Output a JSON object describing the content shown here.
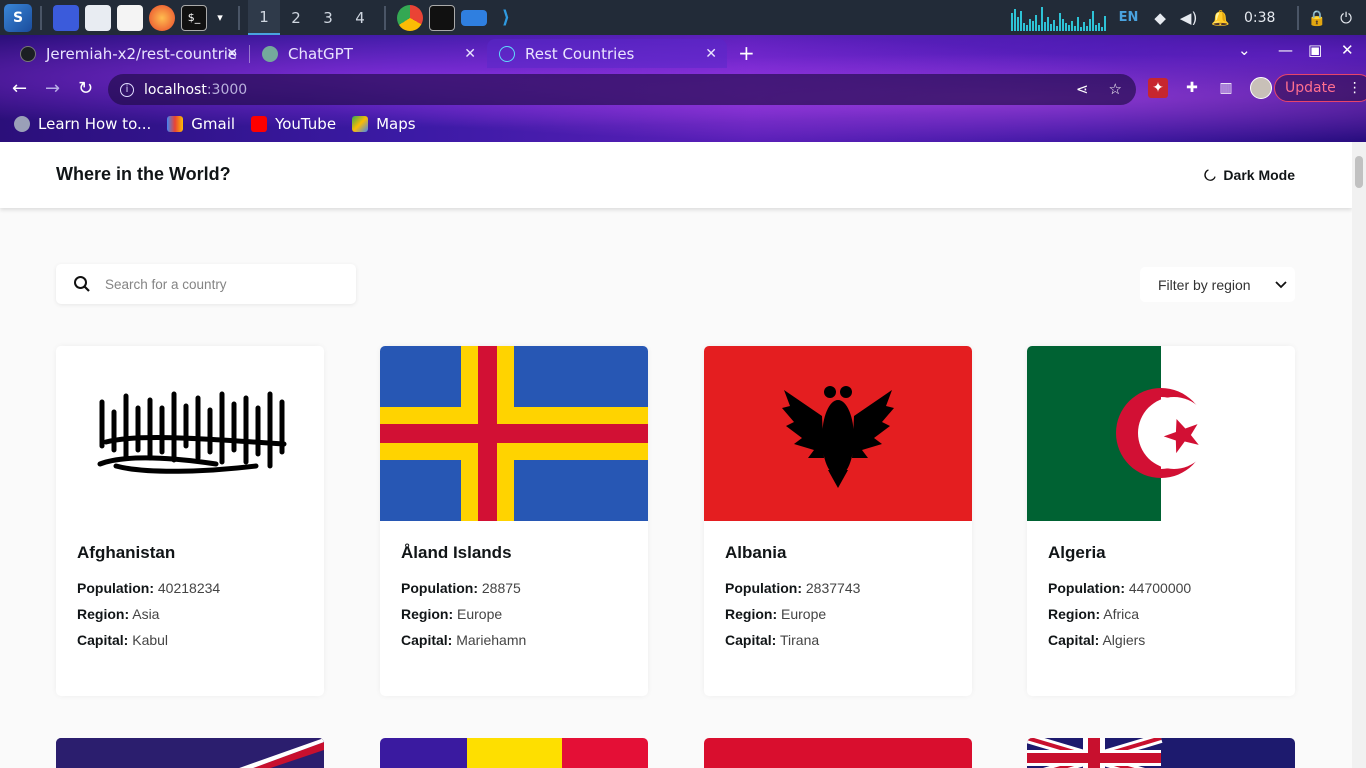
{
  "taskbar": {
    "workspaces": [
      "1",
      "2",
      "3",
      "4"
    ],
    "language": "EN",
    "clock": "0:38"
  },
  "browser": {
    "tabs": [
      {
        "title": "Jeremiah-x2/rest-countrie"
      },
      {
        "title": "ChatGPT"
      },
      {
        "title": "Rest Countries"
      }
    ],
    "url_host": "localhost",
    "url_port": ":3000",
    "update_label": "Update",
    "bookmarks": [
      {
        "label": "Learn How to..."
      },
      {
        "label": "Gmail"
      },
      {
        "label": "YouTube"
      },
      {
        "label": "Maps"
      }
    ]
  },
  "app": {
    "title": "Where in the World?",
    "dark_mode_label": "Dark Mode",
    "search_placeholder": "Search for a country",
    "filter_label": "Filter by region",
    "labels": {
      "population": "Population:",
      "region": "Region:",
      "capital": "Capital:"
    },
    "countries": [
      {
        "name": "Afghanistan",
        "population": "40218234",
        "region": "Asia",
        "capital": "Kabul"
      },
      {
        "name": "Åland Islands",
        "population": "28875",
        "region": "Europe",
        "capital": "Mariehamn"
      },
      {
        "name": "Albania",
        "population": "2837743",
        "region": "Europe",
        "capital": "Tirana"
      },
      {
        "name": "Algeria",
        "population": "44700000",
        "region": "Africa",
        "capital": "Algiers"
      }
    ]
  },
  "colors": {
    "page_bg": "#fafafa",
    "text": "#111517",
    "update_accent": "#e8446a"
  }
}
